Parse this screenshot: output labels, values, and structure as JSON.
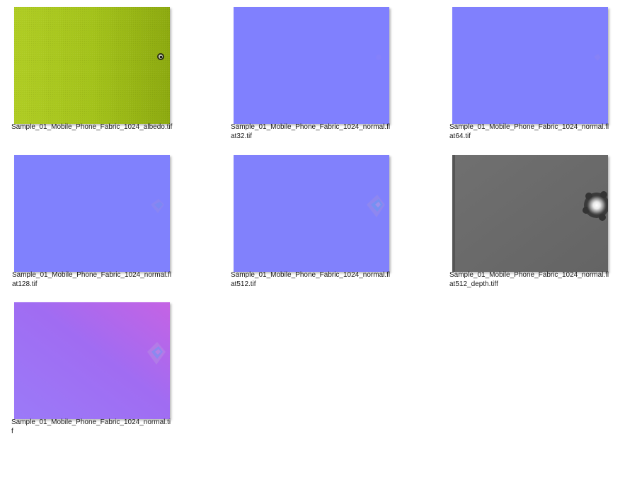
{
  "files": [
    {
      "name_line1": "Sample_01_Mobile_Phone_Fabric_1024_albedo.tif",
      "name_line2": "",
      "thumbnail": "albedo-fabric-yellow-green",
      "colors": {
        "base": "#a7c61c",
        "dark": "#8eae12"
      }
    },
    {
      "name_line1": "Sample_01_Mobile_Phone_Fabric_1024_normal.fl",
      "name_line2": "at32.tif",
      "thumbnail": "normal-map-flat",
      "colors": {
        "base": "#8080ff"
      }
    },
    {
      "name_line1": "Sample_01_Mobile_Phone_Fabric_1024_normal.fl",
      "name_line2": "at64.tif",
      "thumbnail": "normal-map-flat",
      "colors": {
        "base": "#8080ff"
      }
    },
    {
      "name_line1": "Sample_01_Mobile_Phone_Fabric_1024_normal.fl",
      "name_line2": "at128.tif",
      "thumbnail": "normal-map-flat",
      "colors": {
        "base": "#8080ff"
      }
    },
    {
      "name_line1": "Sample_01_Mobile_Phone_Fabric_1024_normal.fl",
      "name_line2": "at512.tif",
      "thumbnail": "normal-map-flat",
      "colors": {
        "base": "#8080ff"
      }
    },
    {
      "name_line1": "Sample_01_Mobile_Phone_Fabric_1024_normal.fl",
      "name_line2": "at512_depth.tiff",
      "thumbnail": "depth-map-gray",
      "colors": {
        "base": "#6b6b6b"
      }
    },
    {
      "name_line1": "Sample_01_Mobile_Phone_Fabric_1024_normal.ti",
      "name_line2": "f",
      "thumbnail": "normal-map-purple",
      "colors": {
        "base": "#9a6cf5",
        "accent": "#c266e6"
      }
    }
  ]
}
